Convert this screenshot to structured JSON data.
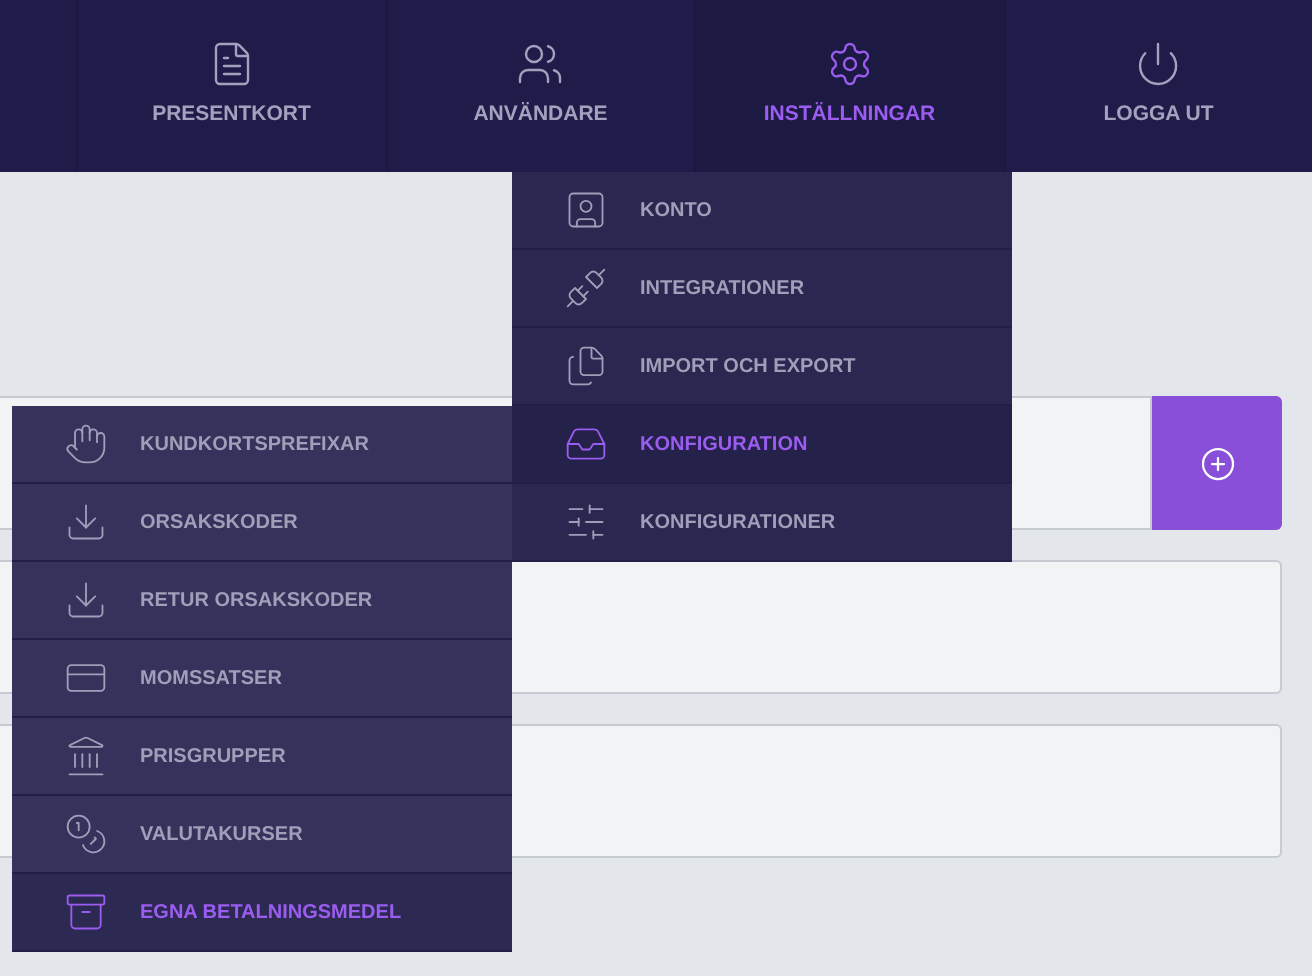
{
  "nav": [
    {
      "label": "PRESENTKORT",
      "selected": false
    },
    {
      "label": "ANVÄNDARE",
      "selected": false
    },
    {
      "label": "INSTÄLLNINGAR",
      "selected": true
    },
    {
      "label": "LOGGA UT",
      "selected": false
    }
  ],
  "settings_menu": [
    {
      "label": "KONTO",
      "selected": false
    },
    {
      "label": "INTEGRATIONER",
      "selected": false
    },
    {
      "label": "IMPORT OCH EXPORT",
      "selected": false
    },
    {
      "label": "KONFIGURATION",
      "selected": true
    },
    {
      "label": "KONFIGURATIONER",
      "selected": false
    }
  ],
  "configuration_menu": [
    {
      "label": "KUNDKORTSPREFIXAR",
      "selected": false
    },
    {
      "label": "ORSAKSKODER",
      "selected": false
    },
    {
      "label": "RETUR ORSAKSKODER",
      "selected": false
    },
    {
      "label": "MOMSSATSER",
      "selected": false
    },
    {
      "label": "PRISGRUPPER",
      "selected": false
    },
    {
      "label": "VALUTAKURSER",
      "selected": false
    },
    {
      "label": "EGNA BETALNINGSMEDEL",
      "selected": true
    }
  ]
}
